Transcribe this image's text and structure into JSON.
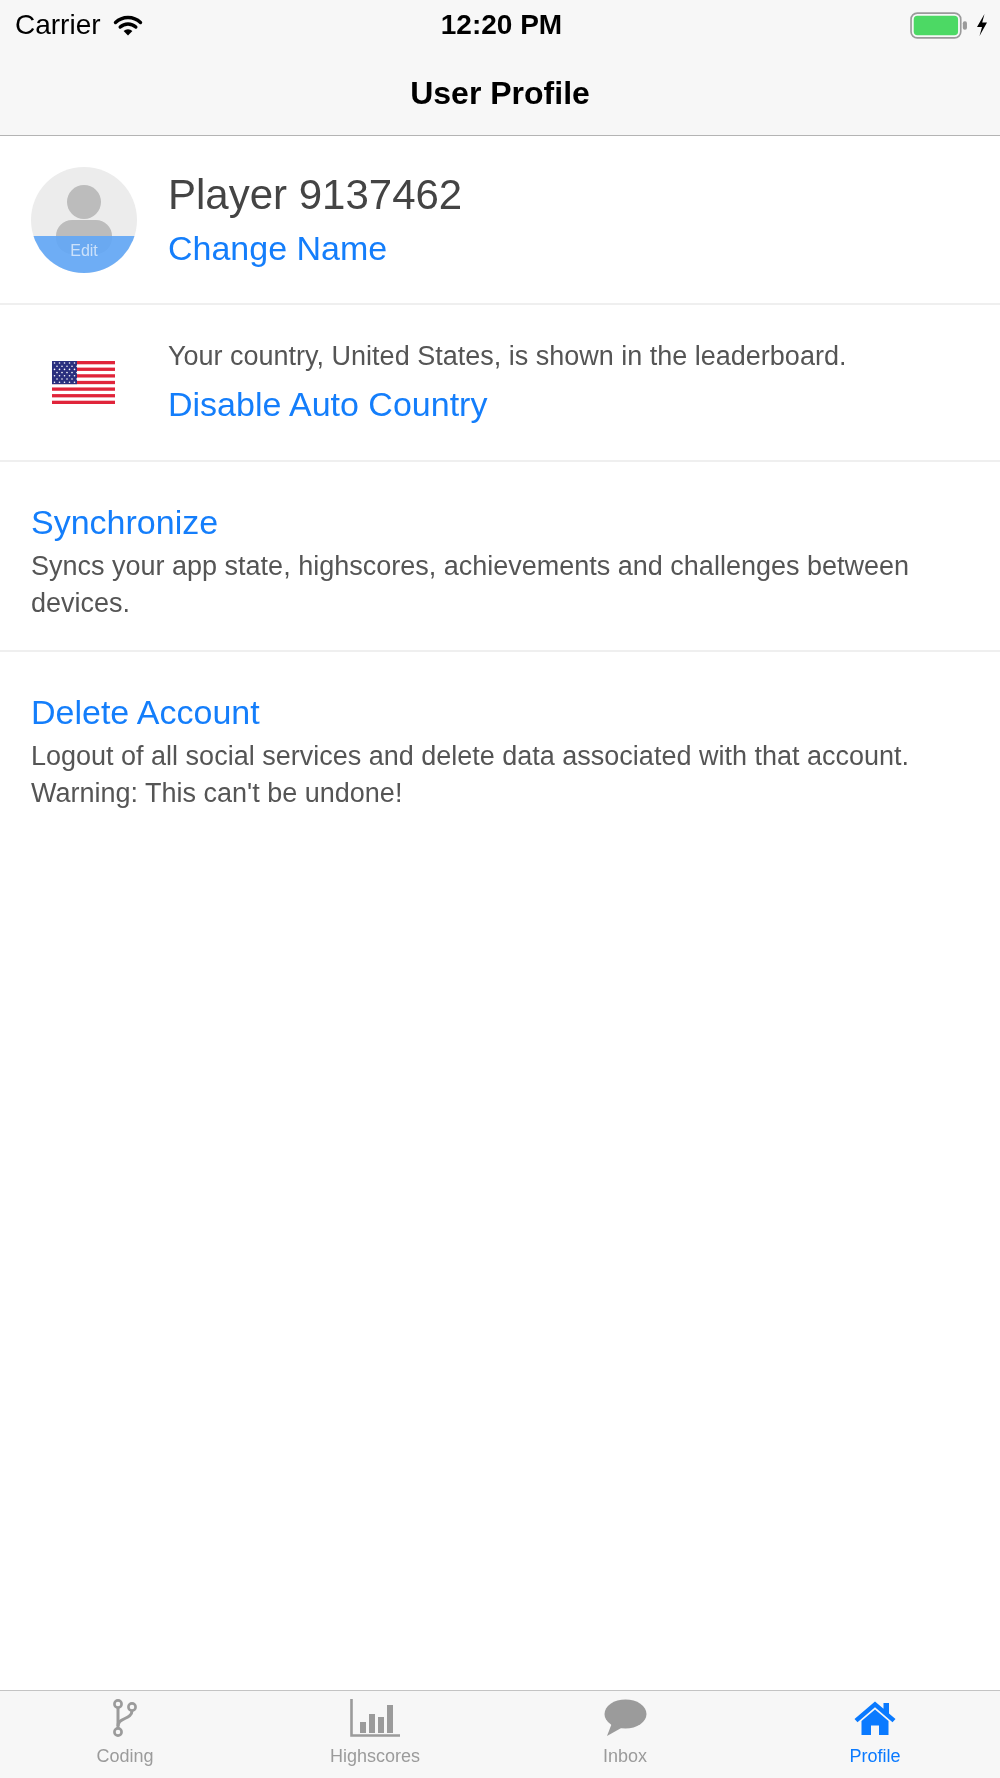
{
  "status_bar": {
    "carrier": "Carrier",
    "time": "12:20 PM",
    "charging": true
  },
  "nav_bar": {
    "title": "User Profile"
  },
  "profile": {
    "avatar_label": "Edit",
    "name": "Player 9137462",
    "change_name_link": "Change Name"
  },
  "country": {
    "message": "Your country, United States, is shown in the leaderboard.",
    "link": "Disable Auto Country"
  },
  "actions": [
    {
      "title": "Synchronize",
      "description": "Syncs your app state, highscores, achievements and challenges between devices."
    },
    {
      "title": "Delete Account",
      "description": "Logout of all social services and delete data associated with that account. Warning: This can't be undone!"
    }
  ],
  "tab_bar": {
    "tabs": [
      {
        "label": "Coding",
        "selected": false
      },
      {
        "label": "Highscores",
        "selected": false
      },
      {
        "label": "Inbox",
        "selected": false
      },
      {
        "label": "Profile",
        "selected": true
      }
    ]
  }
}
